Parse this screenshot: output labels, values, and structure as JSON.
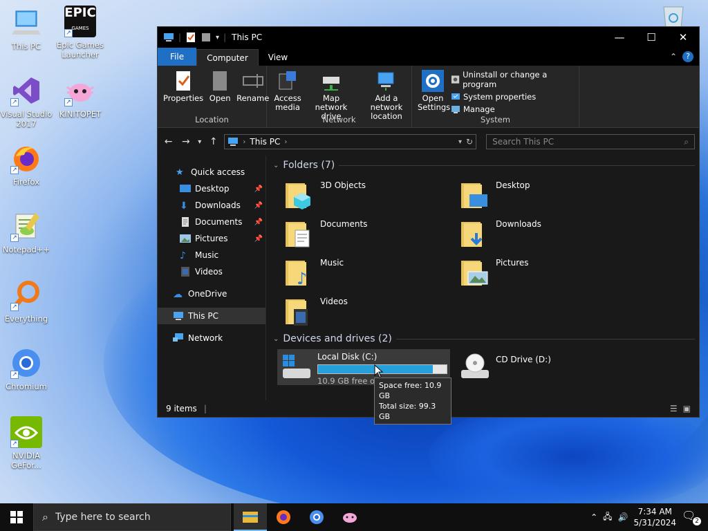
{
  "desktop": {
    "icons": [
      {
        "label": "This PC"
      },
      {
        "label": "Epic Games Launcher"
      },
      {
        "label": "Visual Studio 2017"
      },
      {
        "label": "KINITOPET"
      },
      {
        "label": "Firefox"
      },
      {
        "label": "Notepad++"
      },
      {
        "label": "Everything"
      },
      {
        "label": "Chromium"
      },
      {
        "label": "NVIDIA GeFor..."
      }
    ],
    "epic_logo_text": "EPIC"
  },
  "window": {
    "title": "This PC",
    "tabs": {
      "file": "File",
      "computer": "Computer",
      "view": "View"
    },
    "ribbon": {
      "location": {
        "label": "Location",
        "properties": "Properties",
        "open": "Open",
        "rename": "Rename"
      },
      "network": {
        "label": "Network",
        "access_media": "Access media",
        "map_drive": "Map network drive",
        "add_location": "Add a network location"
      },
      "system": {
        "label": "System",
        "open_settings": "Open Settings",
        "uninstall": "Uninstall or change a program",
        "sys_props": "System properties",
        "manage": "Manage"
      }
    },
    "address": {
      "path": "This PC",
      "search_placeholder": "Search This PC"
    },
    "nav": {
      "quick_access": "Quick access",
      "items": [
        "Desktop",
        "Downloads",
        "Documents",
        "Pictures",
        "Music",
        "Videos"
      ],
      "onedrive": "OneDrive",
      "thispc": "This PC",
      "network": "Network"
    },
    "folders_header": "Folders (7)",
    "folders": [
      "3D Objects",
      "Desktop",
      "Documents",
      "Downloads",
      "Music",
      "Pictures",
      "Videos"
    ],
    "devices_header": "Devices and drives (2)",
    "drives": {
      "c": {
        "name": "Local Disk (C:)",
        "free_text": "10.9 GB free of 99.3 GB",
        "used_fraction": 0.89
      },
      "d": {
        "name": "CD Drive (D:)"
      }
    },
    "tooltip": {
      "line1": "Space free: 10.9 GB",
      "line2": "Total size: 99.3 GB"
    },
    "status": "9 items"
  },
  "taskbar": {
    "search_placeholder": "Type here to search",
    "time": "7:34 AM",
    "date": "5/31/2024",
    "notifications": "2"
  }
}
